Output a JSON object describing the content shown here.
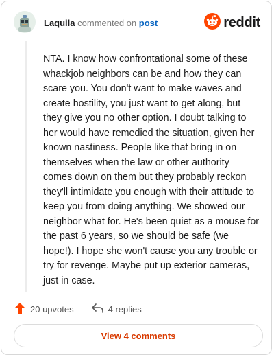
{
  "comment": {
    "username": "Laquila",
    "verb": "commented on",
    "post_link": "post",
    "body": "NTA. I know how confrontational some of these whackjob neighbors can be and how they can scare you. You don't want to make waves and create hostility, you just want to get along, but they give you no other option. I doubt talking to her would have remedied the situation, given her known nastiness. People like that bring in on themselves when the law or other authority comes down on them but they probably reckon they'll intimidate you enough with their attitude to keep you from doing anything. We showed our neighbor what for. He's been quiet as a mouse for the past 6 years, so we should be safe (we hope!). I hope she won't cause you any trouble or try for revenge. Maybe put up exterior cameras, just in case."
  },
  "brand": {
    "name": "reddit",
    "color": "#ff4500"
  },
  "actions": {
    "upvotes": "20 upvotes",
    "replies": "4 replies",
    "view_comments": "View 4 comments"
  },
  "icons": [
    "avatar",
    "reddit-logo-icon",
    "upvote-arrow-icon",
    "reply-arrow-icon"
  ]
}
